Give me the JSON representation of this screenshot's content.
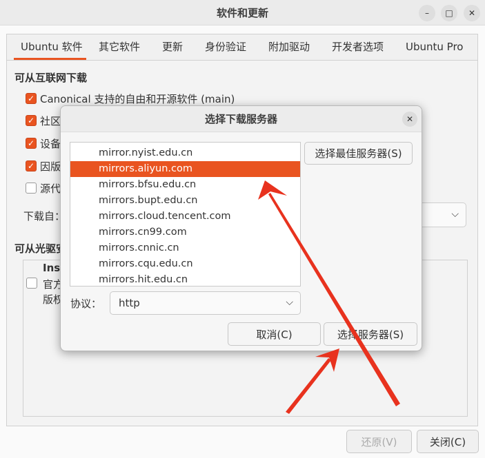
{
  "window": {
    "title": "软件和更新",
    "controls": {
      "minimize": "–",
      "maximize": "□",
      "close": "✕"
    }
  },
  "tabs": [
    {
      "label": "Ubuntu 软件",
      "active": true
    },
    {
      "label": "其它软件"
    },
    {
      "label": "更新"
    },
    {
      "label": "身份验证"
    },
    {
      "label": "附加驱动"
    },
    {
      "label": "开发者选项"
    },
    {
      "label": "Ubuntu Pro"
    }
  ],
  "internet_section": {
    "title": "可从互联网下载",
    "items": [
      {
        "label": "Canonical 支持的自由和开源软件 (main)",
        "checked": true
      },
      {
        "label": "社区",
        "checked": true
      },
      {
        "label": "设备",
        "checked": true
      },
      {
        "label": "因版",
        "checked": true
      },
      {
        "label": "源代",
        "checked": false
      }
    ],
    "download_from_label": "下载自："
  },
  "cd_section": {
    "title": "可从光驱安",
    "cd_line1": "Inst",
    "cd_line2": "官方",
    "cd_line3": "版权"
  },
  "bottom_buttons": {
    "revert": "还原(V)",
    "close": "关闭(C)"
  },
  "dialog": {
    "title": "选择下载服务器",
    "close_glyph": "✕",
    "mirrors": [
      {
        "name": "mirror.nyist.edu.cn",
        "selected": false
      },
      {
        "name": "mirrors.aliyun.com",
        "selected": true
      },
      {
        "name": "mirrors.bfsu.edu.cn",
        "selected": false
      },
      {
        "name": "mirrors.bupt.edu.cn",
        "selected": false
      },
      {
        "name": "mirrors.cloud.tencent.com",
        "selected": false
      },
      {
        "name": "mirrors.cn99.com",
        "selected": false
      },
      {
        "name": "mirrors.cnnic.cn",
        "selected": false
      },
      {
        "name": "mirrors.cqu.edu.cn",
        "selected": false
      },
      {
        "name": "mirrors.hit.edu.cn",
        "selected": false
      }
    ],
    "best_server_button": "选择最佳服务器(S)",
    "protocol_label": "协议：",
    "protocol_value": "http",
    "cancel_button": "取消(C)",
    "choose_button": "选择服务器(S)"
  },
  "colors": {
    "accent": "#e95420",
    "arrow": "#e8321e"
  }
}
